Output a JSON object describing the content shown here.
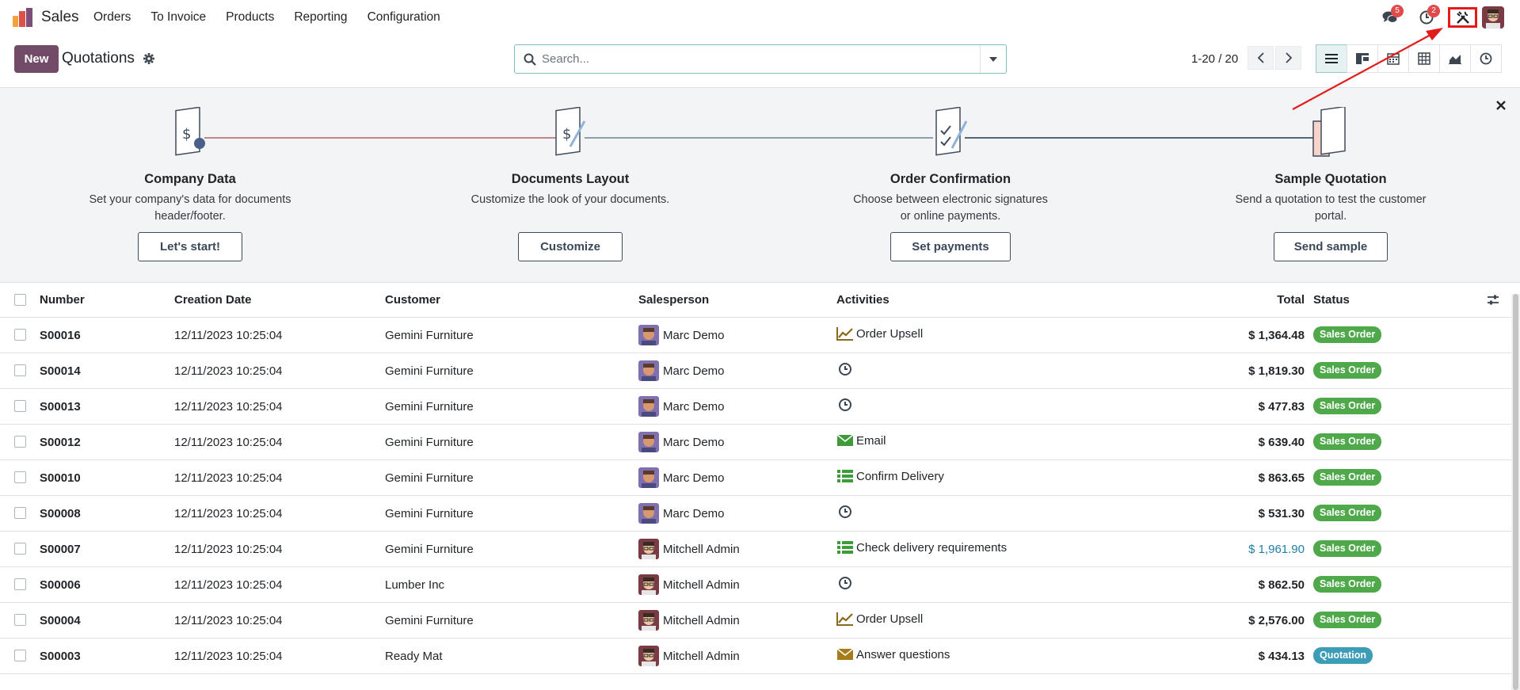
{
  "app": {
    "name": "Sales"
  },
  "menu": [
    "Orders",
    "To Invoice",
    "Products",
    "Reporting",
    "Configuration"
  ],
  "systray": {
    "messages_count": "5",
    "activities_count": "2"
  },
  "control": {
    "new_label": "New",
    "breadcrumb": "Quotations",
    "search_placeholder": "Search...",
    "pager": "1-20 / 20"
  },
  "onboarding": {
    "steps": [
      {
        "title": "Company Data",
        "desc1": "Set your company's data for documents",
        "desc2": "header/footer.",
        "button": "Let's start!"
      },
      {
        "title": "Documents Layout",
        "desc1": "Customize the look of your documents.",
        "desc2": "",
        "button": "Customize"
      },
      {
        "title": "Order Confirmation",
        "desc1": "Choose between electronic signatures",
        "desc2": "or online payments.",
        "button": "Set payments"
      },
      {
        "title": "Sample Quotation",
        "desc1": "Send a quotation to test the customer",
        "desc2": "portal.",
        "button": "Send sample"
      }
    ]
  },
  "table": {
    "headers": {
      "number": "Number",
      "date": "Creation Date",
      "customer": "Customer",
      "salesperson": "Salesperson",
      "activities": "Activities",
      "total": "Total",
      "status": "Status"
    },
    "rows": [
      {
        "number": "S00016",
        "date": "12/11/2023 10:25:04",
        "customer": "Gemini Furniture",
        "salesperson": "Marc Demo",
        "activity": "Order Upsell",
        "activity_icon": "chart-line-icon",
        "total": "$ 1,364.48",
        "status": "Sales Order"
      },
      {
        "number": "S00014",
        "date": "12/11/2023 10:25:04",
        "customer": "Gemini Furniture",
        "salesperson": "Marc Demo",
        "activity": "",
        "activity_icon": "clock-icon",
        "total": "$ 1,819.30",
        "status": "Sales Order"
      },
      {
        "number": "S00013",
        "date": "12/11/2023 10:25:04",
        "customer": "Gemini Furniture",
        "salesperson": "Marc Demo",
        "activity": "",
        "activity_icon": "clock-icon",
        "total": "$ 477.83",
        "status": "Sales Order"
      },
      {
        "number": "S00012",
        "date": "12/11/2023 10:25:04",
        "customer": "Gemini Furniture",
        "salesperson": "Marc Demo",
        "activity": "Email",
        "activity_icon": "envelope-icon",
        "total": "$ 639.40",
        "status": "Sales Order"
      },
      {
        "number": "S00010",
        "date": "12/11/2023 10:25:04",
        "customer": "Gemini Furniture",
        "salesperson": "Marc Demo",
        "activity": "Confirm Delivery",
        "activity_icon": "tasks-icon",
        "total": "$ 863.65",
        "status": "Sales Order"
      },
      {
        "number": "S00008",
        "date": "12/11/2023 10:25:04",
        "customer": "Gemini Furniture",
        "salesperson": "Marc Demo",
        "activity": "",
        "activity_icon": "clock-icon",
        "total": "$ 531.30",
        "status": "Sales Order"
      },
      {
        "number": "S00007",
        "date": "12/11/2023 10:25:04",
        "customer": "Gemini Furniture",
        "salesperson": "Mitchell Admin",
        "activity": "Check delivery requirements",
        "activity_icon": "tasks-icon",
        "total": "$ 1,961.90",
        "status": "Sales Order"
      },
      {
        "number": "S00006",
        "date": "12/11/2023 10:25:04",
        "customer": "Lumber Inc",
        "salesperson": "Mitchell Admin",
        "activity": "",
        "activity_icon": "clock-icon",
        "total": "$ 862.50",
        "status": "Sales Order"
      },
      {
        "number": "S00004",
        "date": "12/11/2023 10:25:04",
        "customer": "Gemini Furniture",
        "salesperson": "Mitchell Admin",
        "activity": "Order Upsell",
        "activity_icon": "chart-line-icon",
        "total": "$ 2,576.00",
        "status": "Sales Order"
      },
      {
        "number": "S00003",
        "date": "12/11/2023 10:25:04",
        "customer": "Ready Mat",
        "salesperson": "Mitchell Admin",
        "activity": "Answer questions",
        "activity_icon": "envelope-icon",
        "total": "$ 434.13",
        "status": "Quotation"
      }
    ]
  },
  "colors": {
    "brand": "#714b67",
    "sales_order": "#4fa84a",
    "quotation": "#3d9db7",
    "annotation": "#e31b1b"
  }
}
